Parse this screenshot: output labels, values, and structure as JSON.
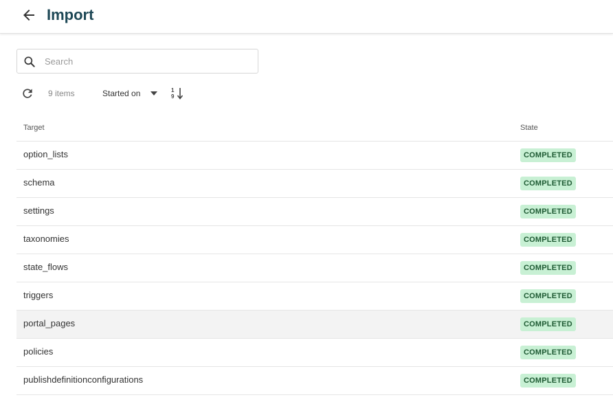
{
  "header": {
    "title": "Import",
    "back_icon": "arrow-left-icon"
  },
  "search": {
    "placeholder": "Search",
    "value": ""
  },
  "toolbar": {
    "refresh_icon": "refresh-icon",
    "item_count": "9 items",
    "sort_field": "Started on",
    "sort_caret_icon": "caret-down-icon",
    "sort_direction_icon": "sort-descending-icon"
  },
  "table": {
    "columns": {
      "target": "Target",
      "state": "State"
    },
    "rows": [
      {
        "target": "option_lists",
        "state": "COMPLETED"
      },
      {
        "target": "schema",
        "state": "COMPLETED"
      },
      {
        "target": "settings",
        "state": "COMPLETED"
      },
      {
        "target": "taxonomies",
        "state": "COMPLETED"
      },
      {
        "target": "state_flows",
        "state": "COMPLETED"
      },
      {
        "target": "triggers",
        "state": "COMPLETED"
      },
      {
        "target": "portal_pages",
        "state": "COMPLETED"
      },
      {
        "target": "policies",
        "state": "COMPLETED"
      },
      {
        "target": "publishdefinitionconfigurations",
        "state": "COMPLETED"
      }
    ]
  },
  "colors": {
    "title": "#1e4856",
    "badge_bg": "#c8f0d4",
    "badge_text": "#1e5a33",
    "row_hover": "#f3f3f3"
  }
}
